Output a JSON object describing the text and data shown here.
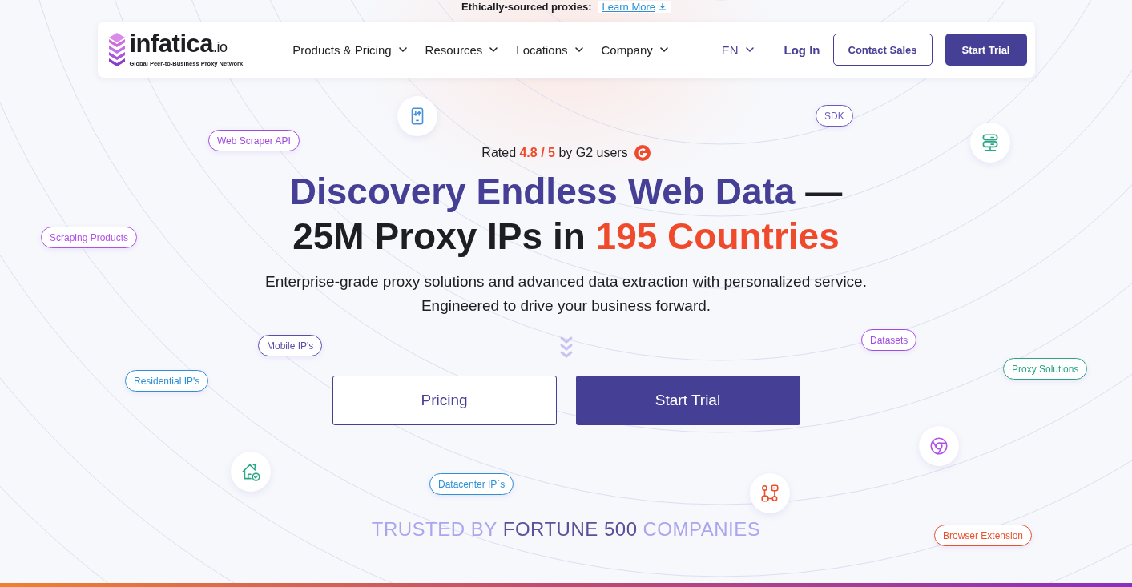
{
  "announcement": {
    "text": "Ethically-sourced proxies:",
    "link": "Learn More"
  },
  "header": {
    "logo": {
      "name": "infatica",
      "suffix": ".io",
      "tagline": "Global Peer-to-Business Proxy Network"
    },
    "nav": [
      "Products & Pricing",
      "Resources",
      "Locations",
      "Company"
    ],
    "language": "EN",
    "login": "Log In",
    "contact_button": "Contact Sales",
    "trial_button": "Start Trial"
  },
  "hero": {
    "rating": "Rated **4.8 / 5** by G2 users",
    "headline": [
      [
        {
          "text": "Discovery Endless Web Data",
          "color": "#463f96"
        },
        {
          "text": " —",
          "color": "#1d1d22"
        }
      ],
      [
        {
          "text": "25M Proxy IPs in ",
          "color": "#1d1d22"
        },
        {
          "text": "195 Countries",
          "color": "#f04a2d"
        }
      ]
    ],
    "subtitle": [
      "Enterprise-grade proxy solutions and advanced data extraction with personalized service.",
      "Engineered to drive your business forward."
    ],
    "buttons": [
      {
        "label": "Pricing",
        "kind": "outline"
      },
      {
        "label": "Start Trial",
        "kind": "filled"
      }
    ],
    "trusted": [
      {
        "text": "TRUSTED BY",
        "emphasis": false
      },
      {
        "text": "FORTUNE 500",
        "emphasis": true
      },
      {
        "text": "COMPANIES",
        "emphasis": false
      }
    ]
  },
  "tags": [
    {
      "label": "Web Scraper API",
      "color": "#a24be0"
    },
    {
      "label": "SDK",
      "color": "#6b5cc0"
    },
    {
      "label": "Scraping Products",
      "color": "#b052e8"
    },
    {
      "label": "Mobile IP's",
      "color": "#5a4fa8"
    },
    {
      "label": "Datasets",
      "color": "#a24be0"
    },
    {
      "label": "Residential IP's",
      "color": "#2d8fd6"
    },
    {
      "label": "Proxy Solutions",
      "color": "#2aa585"
    },
    {
      "label": "Datacenter IP`s",
      "color": "#2d8fd6"
    },
    {
      "label": "Browser Extension",
      "color": "#e8502e"
    }
  ]
}
